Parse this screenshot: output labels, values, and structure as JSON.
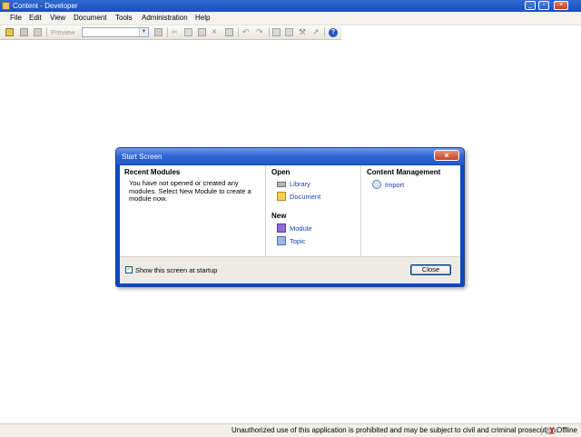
{
  "window": {
    "title": "Content - Developer",
    "min_glyph": "_",
    "max_glyph": "▫",
    "close_glyph": "×"
  },
  "menu": {
    "items": [
      "File",
      "Edit",
      "View",
      "Document",
      "Tools",
      "Administration",
      "Help"
    ]
  },
  "toolbar": {
    "preview_label": "Preview",
    "module_select_value": "",
    "icons": [
      "open-folder-icon",
      "save-icon",
      "print-icon",
      "preview-icon",
      "new-icon",
      "cut-icon",
      "copy-icon",
      "paste-icon",
      "delete-icon",
      "properties-icon",
      "undo-icon",
      "redo-icon",
      "indent-icon",
      "outdent-icon",
      "tools-icon",
      "help-icon"
    ]
  },
  "dialog": {
    "title": "Start Screen",
    "close_glyph": "×",
    "recent": {
      "heading": "Recent Modules",
      "text": "You have not opened or created any modules.  Select New Module to create a module now."
    },
    "open": {
      "heading": "Open",
      "items": [
        {
          "label": "Library",
          "icon": "library-icon"
        },
        {
          "label": "Document",
          "icon": "folder-icon"
        }
      ]
    },
    "new": {
      "heading": "New",
      "items": [
        {
          "label": "Module",
          "icon": "module-icon"
        },
        {
          "label": "Topic",
          "icon": "topic-icon"
        }
      ]
    },
    "content_management": {
      "heading": "Content Management",
      "items": [
        {
          "label": "Import",
          "icon": "import-icon"
        }
      ]
    },
    "footer": {
      "checkbox_label": "Show this screen at startup",
      "checked": true,
      "checkmark": "✓",
      "close_label": "Close"
    }
  },
  "status": {
    "message": "Unauthorized use of this application is prohibited and may be subject to civil and criminal prosecution.",
    "connection": "Offline"
  },
  "colors": {
    "title_bar": "#2559c6",
    "link": "#1a3fbf",
    "dialog_face": "#ecebe5"
  }
}
